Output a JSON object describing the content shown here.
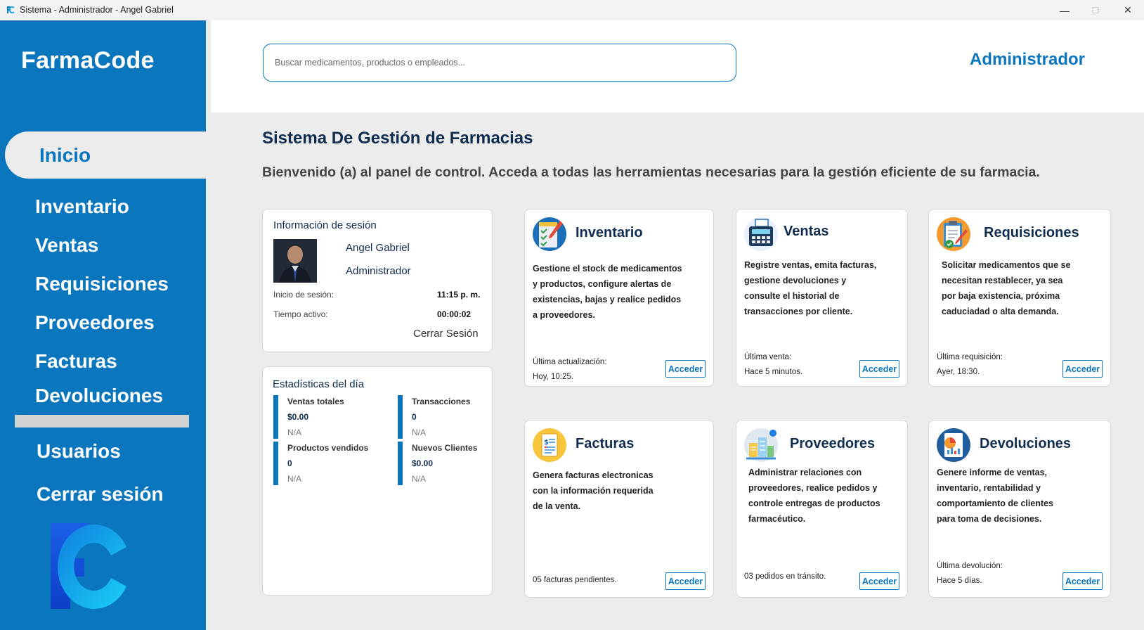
{
  "window": {
    "title": "Sistema - Administrador - Angel Gabriel",
    "min_glyph": "—",
    "max_glyph": "☐",
    "close_glyph": "✕"
  },
  "sidebar": {
    "brand": "FarmaCode",
    "active": "Inicio",
    "items": [
      "Inventario",
      "Ventas",
      "Requisiciones",
      "Proveedores",
      "Facturas",
      "Devoluciones"
    ],
    "users": "Usuarios",
    "logout": "Cerrar sesión",
    "accent": "#0a76bd"
  },
  "header": {
    "search_placeholder": "Buscar medicamentos, productos o empleados...",
    "role": "Administrador"
  },
  "main": {
    "title": "Sistema De Gestión de Farmacias",
    "welcome": "Bienvenido (a) al panel de control. Acceda a todas las herramientas necesarias para la gestión eficiente de su farmacia."
  },
  "session": {
    "title": "Información de sesión",
    "name": "Angel Gabriel",
    "role": "Administrador",
    "start_label": "Inicio de sesión:",
    "start_value": "11:15 p. m.",
    "active_label": "Tiempo activo:",
    "active_value": "00:00:02",
    "logout": "Cerrar Sesión"
  },
  "stats": {
    "title": "Estadísticas del día",
    "items": [
      {
        "label": "Ventas totales",
        "value": "$0.00",
        "note": "N/A"
      },
      {
        "label": "Transacciones",
        "value": "0",
        "note": "N/A"
      },
      {
        "label": "Productos vendidos",
        "value": "0",
        "note": "N/A"
      },
      {
        "label": "Nuevos Clientes",
        "value": "$0.00",
        "note": "N/A"
      }
    ]
  },
  "modules": [
    {
      "title": "Inventario",
      "icon": "inventory-icon",
      "desc": "Gestione el stock de medicamentos\ny productos, configure alertas de\nexistencias, bajas y realice pedidos\na proveedores.",
      "footer": "Última actualización:\nHoy, 10:25.",
      "button": "Acceder"
    },
    {
      "title": "Ventas",
      "icon": "cash-register-icon",
      "desc": "Registre ventas, emita facturas,\ngestione devoluciones y\nconsulte el historial de\ntransacciones por cliente.",
      "footer": "Última venta:\nHace 5 minutos.",
      "button": "Acceder"
    },
    {
      "title": "Requisiciones",
      "icon": "clipboard-icon",
      "desc": "Solicitar medicamentos que se\nnecesitan restablecer, ya sea\npor baja existencia, próxima\ncaduciadad o alta demanda.",
      "footer": "Última requisición:\nAyer, 18:30.",
      "button": "Acceder"
    },
    {
      "title": "Facturas",
      "icon": "invoice-icon",
      "desc": "Genera facturas electronicas\ncon la información requerida\nde la venta.",
      "footer": "05 facturas pendientes.",
      "button": "Acceder"
    },
    {
      "title": "Proveedores",
      "icon": "supplier-icon",
      "desc": "Administrar relaciones con\nproveedores, realice pedidos y\ncontrole entregas de productos\nfarmacéutico.",
      "footer": "03 pedidos en tránsito.",
      "button": "Acceder"
    },
    {
      "title": "Devoluciones",
      "icon": "report-icon",
      "desc": "Genere informe de ventas,\ninventario, rentabilidad y\ncomportamiento de clientes\npara toma de decisiones.",
      "footer": "Última devolución:\nHace 5 días.",
      "button": "Acceder"
    }
  ]
}
